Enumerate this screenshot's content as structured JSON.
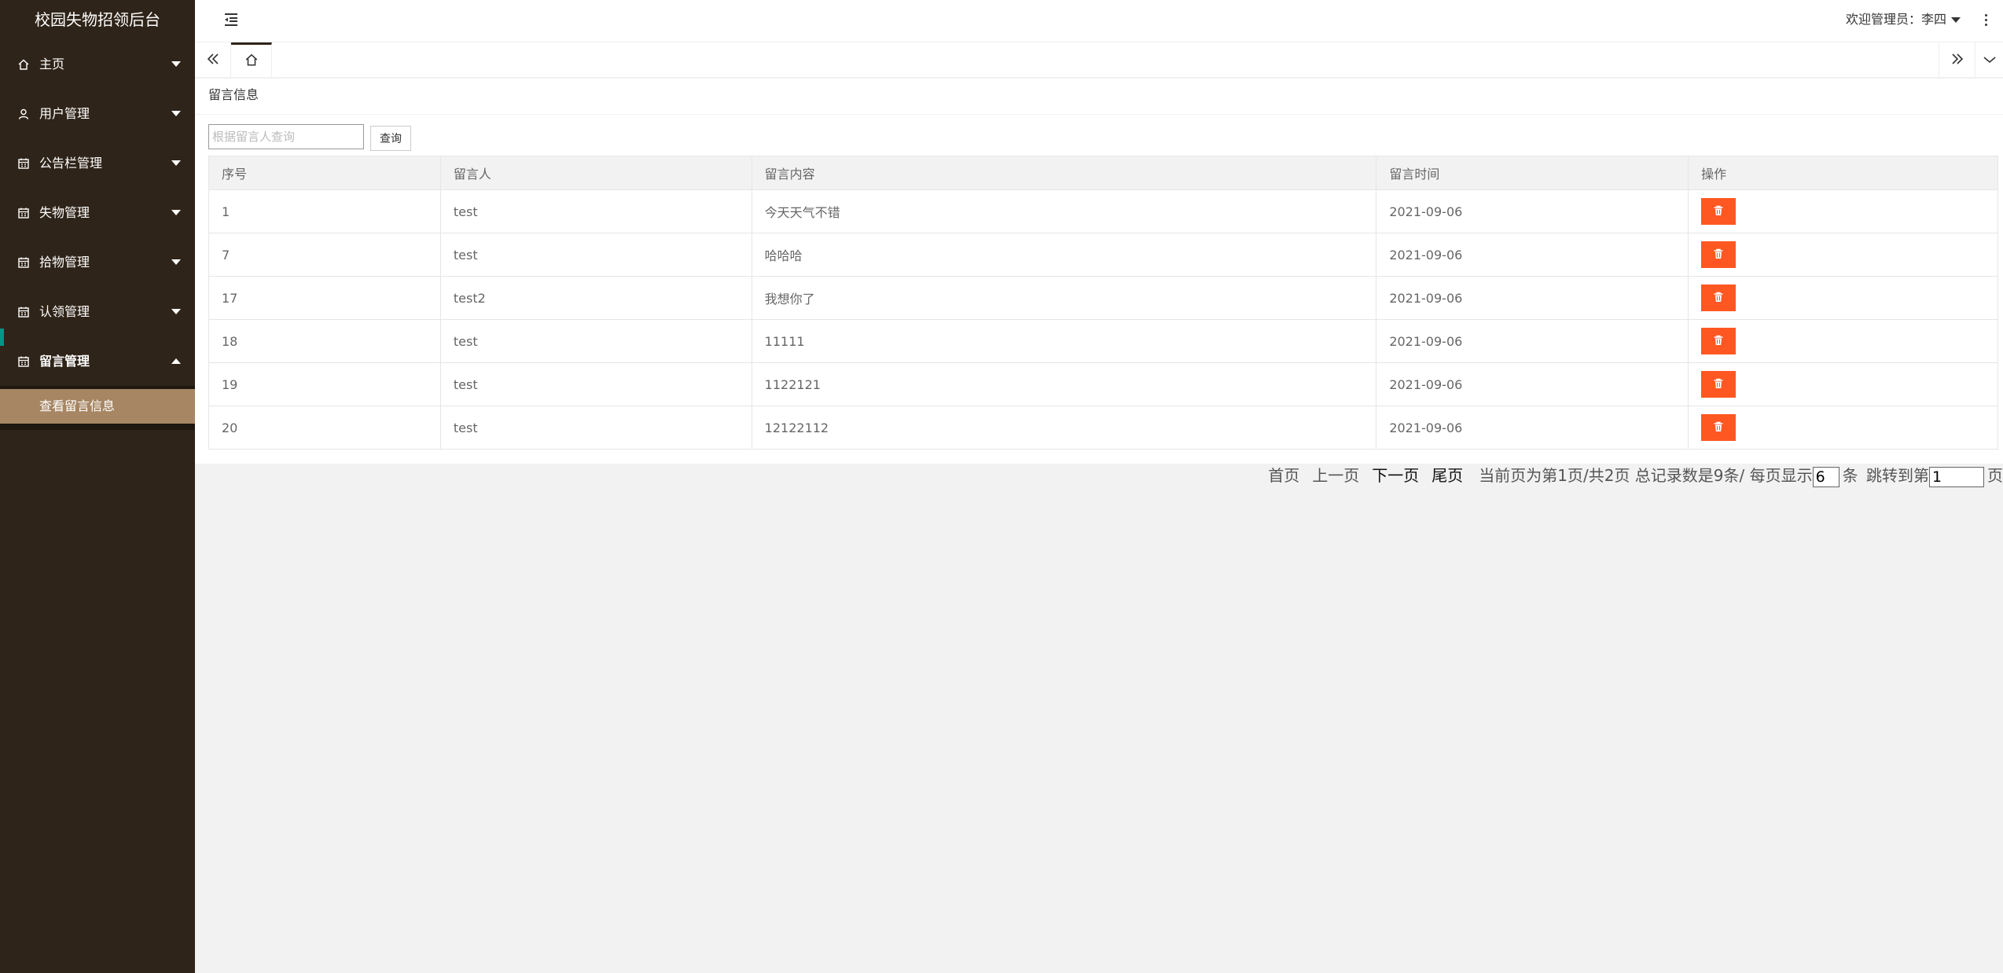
{
  "sidebar": {
    "brand": "校园失物招领后台",
    "items": [
      {
        "label": "主页",
        "icon": "home-icon"
      },
      {
        "label": "用户管理",
        "icon": "user-icon"
      },
      {
        "label": "公告栏管理",
        "icon": "calendar-icon"
      },
      {
        "label": "失物管理",
        "icon": "calendar-icon"
      },
      {
        "label": "拾物管理",
        "icon": "calendar-icon"
      },
      {
        "label": "认领管理",
        "icon": "calendar-icon"
      },
      {
        "label": "留言管理",
        "icon": "calendar-icon"
      }
    ],
    "sub_items": [
      {
        "label": "查看留言信息"
      }
    ]
  },
  "header": {
    "welcome": "欢迎管理员：李四"
  },
  "page": {
    "title": "留言信息",
    "search_placeholder": "根据留言人查询",
    "search_button": "查询"
  },
  "table": {
    "columns": [
      "序号",
      "留言人",
      "留言内容",
      "留言时间",
      "操作"
    ],
    "rows": [
      {
        "id": "1",
        "user": "test",
        "content": "今天天气不错",
        "time": "2021-09-06"
      },
      {
        "id": "7",
        "user": "test",
        "content": "哈哈哈",
        "time": "2021-09-06"
      },
      {
        "id": "17",
        "user": "test2",
        "content": "我想你了",
        "time": "2021-09-06"
      },
      {
        "id": "18",
        "user": "test",
        "content": "11111",
        "time": "2021-09-06"
      },
      {
        "id": "19",
        "user": "test",
        "content": "1122121",
        "time": "2021-09-06"
      },
      {
        "id": "20",
        "user": "test",
        "content": "12122112",
        "time": "2021-09-06"
      }
    ]
  },
  "pager": {
    "first": "首页",
    "prev": "上一页",
    "next": "下一页",
    "last": "尾页",
    "info": "当前页为第1页/共2页 总记录数是9条/ 每页显示",
    "page_size": "6",
    "unit": "条",
    "jump_label": "跳转到第",
    "jump_value": "1",
    "page_suffix": "页"
  },
  "colors": {
    "sidebar_bg": "#2f2419",
    "sub_active_bg": "#a68663",
    "delete_btn": "#ff5722"
  }
}
